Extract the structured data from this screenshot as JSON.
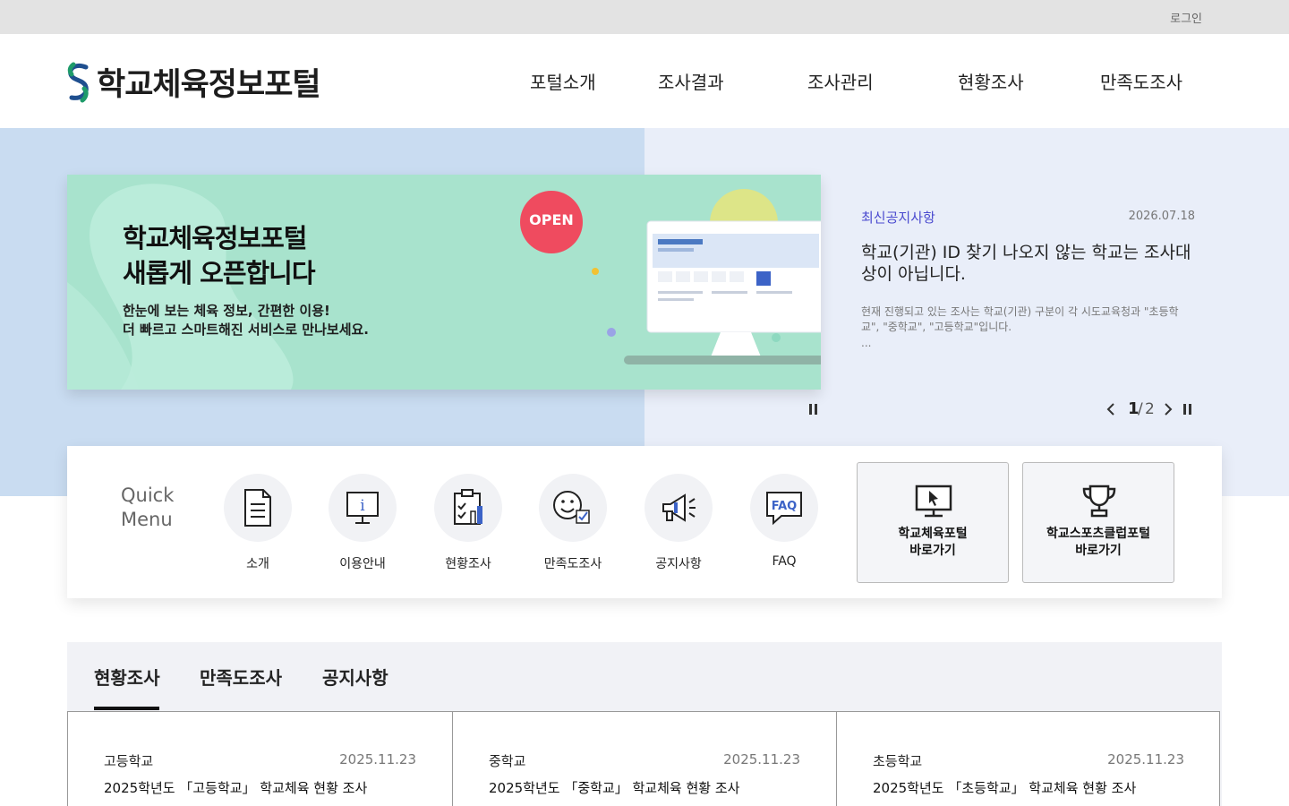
{
  "utility": {
    "login": "로그인"
  },
  "header": {
    "logo_text": "학교체육정보포털",
    "nav": [
      "포털소개",
      "조사결과",
      "조사관리",
      "현황조사",
      "만족도조사"
    ]
  },
  "banner": {
    "title_line1": "학교체육정보포털",
    "title_line2": "새롭게 오픈합니다",
    "sub_line1": "한눈에 보는 체육 정보, 간편한 이용!",
    "sub_line2": "더 빠르고 스마트해진 서비스로 만나보세요.",
    "badge": "OPEN"
  },
  "notice": {
    "category": "최신공지사항",
    "date": "2026.07.18",
    "title": "학교(기관) ID 찾기 나오지 않는 학교는 조사대상이 아닙니다.",
    "body": "현재 진행되고 있는 조사는 학교(기관) 구분이 각 시도교육청과 \"초등학교\", \"중학교\", \"고등학교\"입니다.",
    "ellipsis": "...",
    "pager": {
      "current": "1",
      "separator": "/",
      "total": "2"
    }
  },
  "quick_menu": {
    "label_line1": "Quick",
    "label_line2": "Menu",
    "items": [
      {
        "label": "소개",
        "icon": "document-icon"
      },
      {
        "label": "이용안내",
        "icon": "info-board-icon"
      },
      {
        "label": "현황조사",
        "icon": "clipboard-chart-icon"
      },
      {
        "label": "만족도조사",
        "icon": "smiley-check-icon"
      },
      {
        "label": "공지사항",
        "icon": "megaphone-icon"
      },
      {
        "label": "FAQ",
        "icon": "faq-bubble-icon"
      }
    ],
    "portals": [
      {
        "line1": "학교체육포털",
        "line2": "바로가기",
        "icon": "monitor-cursor-icon"
      },
      {
        "line1": "학교스포츠클럽포털",
        "line2": "바로가기",
        "icon": "trophy-icon"
      }
    ]
  },
  "board": {
    "tabs": [
      "현황조사",
      "만족도조사",
      "공지사항"
    ],
    "active_tab": "현황조사",
    "cards": [
      {
        "category": "고등학교",
        "date": "2025.11.23",
        "title": "2025학년도 「고등학교」 학교체육 현황 조사"
      },
      {
        "category": "중학교",
        "date": "2025.11.23",
        "title": "2025학년도 「중학교」 학교체육 현황 조사"
      },
      {
        "category": "초등학교",
        "date": "2025.11.23",
        "title": "2025학년도 「초등학교」 학교체육 현황 조사"
      }
    ]
  },
  "colors": {
    "utility_bg": "#e3e3e3",
    "hero_left_bg": "#c9dcf1",
    "hero_right_bg": "#e9eef9",
    "banner_bg": "#a8e3cd",
    "open_badge": "#ef4b5f",
    "notice_category": "#4a4acf",
    "logo_green": "#1e9b6a",
    "logo_navy": "#1f4f8f"
  }
}
